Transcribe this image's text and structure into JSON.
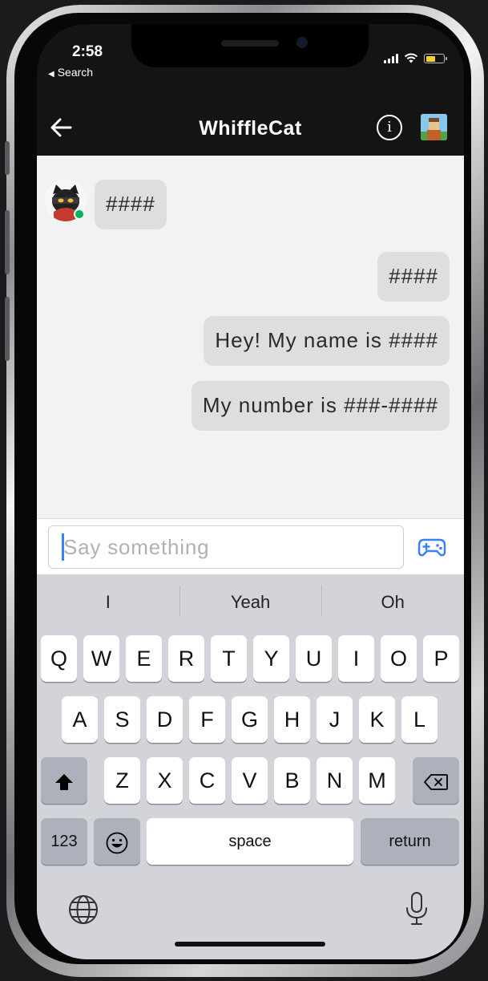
{
  "status_bar": {
    "time": "2:58",
    "back_app": "Search",
    "battery_color": "#f5d130"
  },
  "header": {
    "title": "WhiffleCat",
    "back_icon": "arrow-left-icon",
    "info_icon": "info-icon",
    "avatar_icon": "group-avatar-icon"
  },
  "messages": [
    {
      "direction": "incoming",
      "text": "####"
    },
    {
      "direction": "outgoing",
      "text": "####"
    },
    {
      "direction": "outgoing",
      "text": "Hey! My name is ####"
    },
    {
      "direction": "outgoing",
      "text": "My number is ###-####"
    }
  ],
  "composer": {
    "placeholder": "Say something",
    "value": "",
    "game_icon": "gamepad-icon",
    "accent_color": "#3a80f7"
  },
  "keyboard": {
    "suggestions": [
      "I",
      "Yeah",
      "Oh"
    ],
    "row1": [
      "Q",
      "W",
      "E",
      "R",
      "T",
      "Y",
      "U",
      "I",
      "O",
      "P"
    ],
    "row2": [
      "A",
      "S",
      "D",
      "F",
      "G",
      "H",
      "J",
      "K",
      "L"
    ],
    "row3": [
      "Z",
      "X",
      "C",
      "V",
      "B",
      "N",
      "M"
    ],
    "numbers_label": "123",
    "space_label": "space",
    "return_label": "return"
  }
}
